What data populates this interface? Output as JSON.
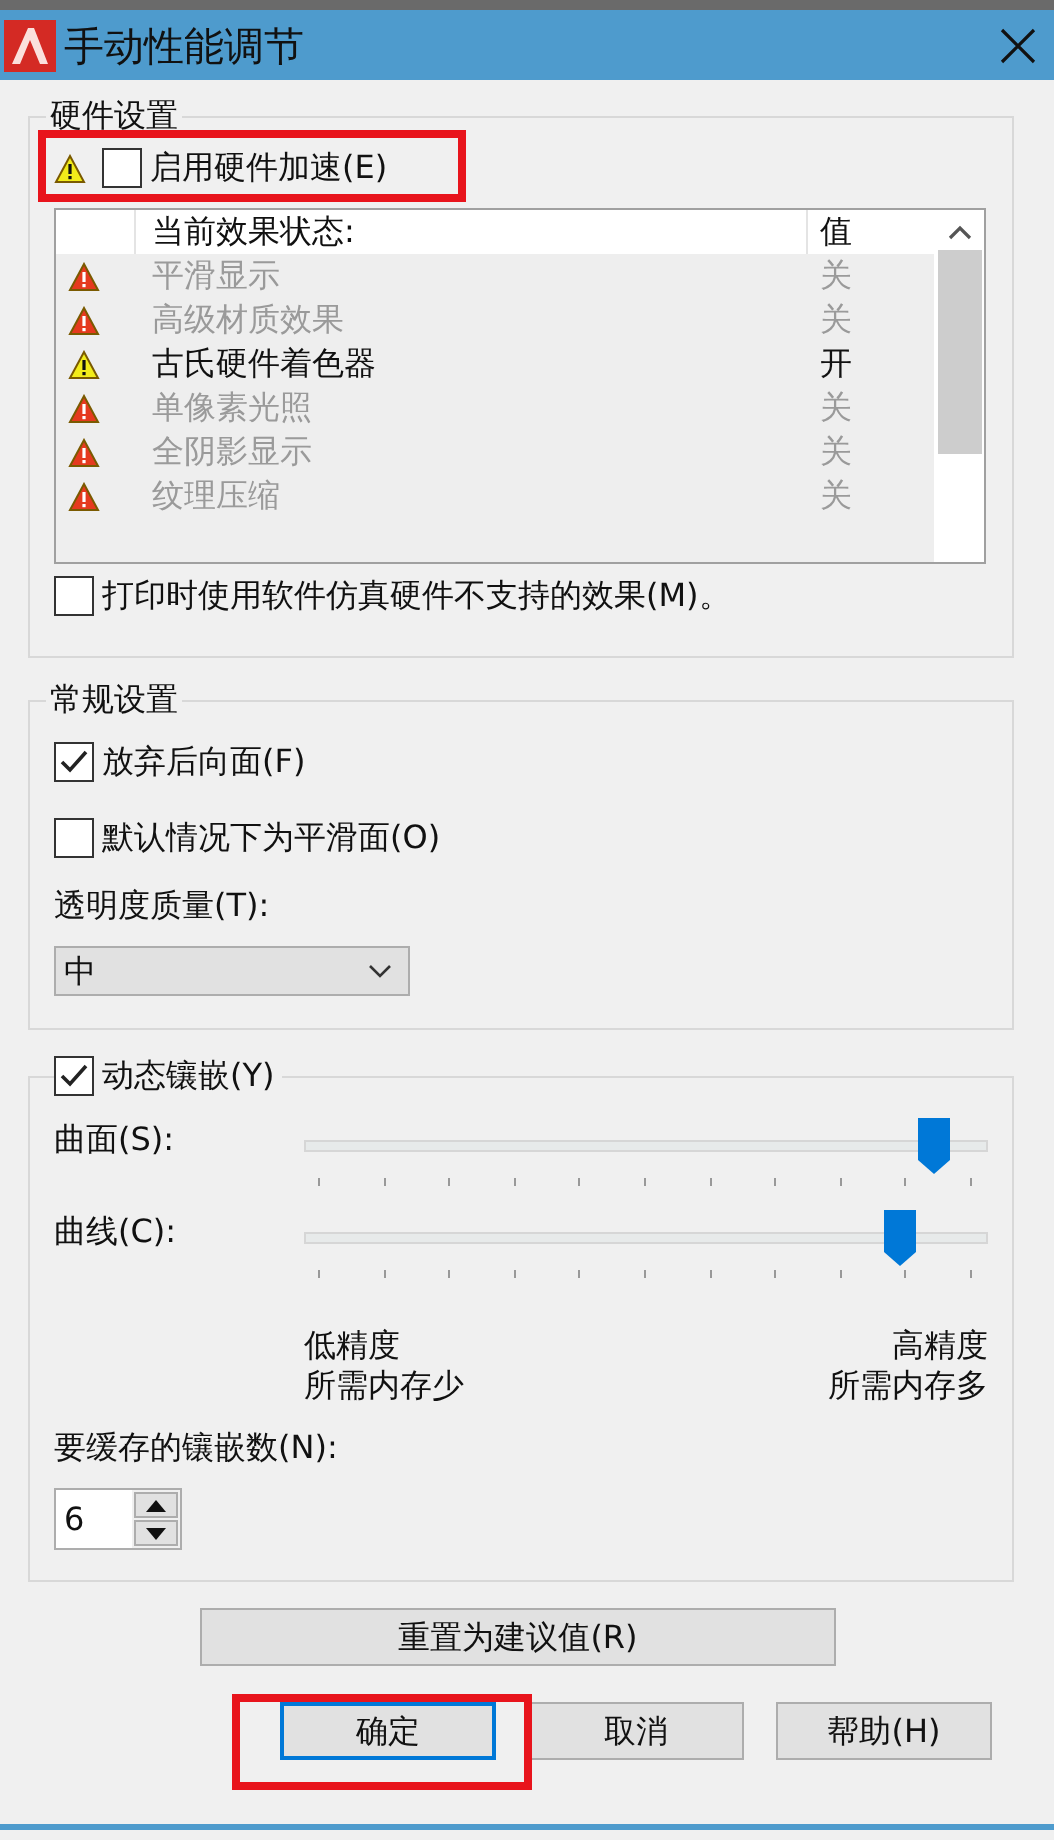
{
  "window": {
    "title": "手动性能调节"
  },
  "hardware": {
    "legend": "硬件设置",
    "acceleration": {
      "label": "启用硬件加速(E)",
      "checked": false,
      "highlighted": true
    },
    "effects": {
      "columns": [
        "当前效果状态:",
        "值"
      ],
      "rows": [
        {
          "kind": "error",
          "name": "平滑显示",
          "value": "关",
          "disabled": true
        },
        {
          "kind": "error",
          "name": "高级材质效果",
          "value": "关",
          "disabled": true
        },
        {
          "kind": "warning",
          "name": "古氏硬件着色器",
          "value": "开",
          "disabled": false
        },
        {
          "kind": "error",
          "name": "单像素光照",
          "value": "关",
          "disabled": true
        },
        {
          "kind": "error",
          "name": "全阴影显示",
          "value": "关",
          "disabled": true
        },
        {
          "kind": "error",
          "name": "纹理压缩",
          "value": "关",
          "disabled": true
        }
      ]
    },
    "print_emulation": {
      "label": "打印时使用软件仿真硬件不支持的效果(M)。",
      "checked": false
    }
  },
  "general": {
    "legend": "常规设置",
    "options": [
      {
        "label": "放弃后向面(F)",
        "checked": true
      },
      {
        "label": "默认情况下为平滑面(O)",
        "checked": false
      }
    ],
    "transparency": {
      "label": "透明度质量(T):",
      "value": "中"
    }
  },
  "tessellation": {
    "label": "动态镶嵌(Y)",
    "checked": true,
    "sliders": [
      {
        "label": "曲面(S):",
        "level": 0.92
      },
      {
        "label": "曲线(C):",
        "level": 0.87
      }
    ],
    "scale": {
      "low": [
        "低精度",
        "所需内存少"
      ],
      "high": [
        "高精度",
        "所需内存多"
      ]
    },
    "cache": {
      "label": "要缓存的镶嵌数(N):",
      "value": "6"
    }
  },
  "reset_button": "重置为建议值(R)",
  "buttons": [
    {
      "label": "确定",
      "focused": true,
      "highlighted": true
    },
    {
      "label": "取消",
      "focused": false,
      "highlighted": false
    },
    {
      "label": "帮助(H)",
      "focused": false,
      "highlighted": false
    }
  ]
}
